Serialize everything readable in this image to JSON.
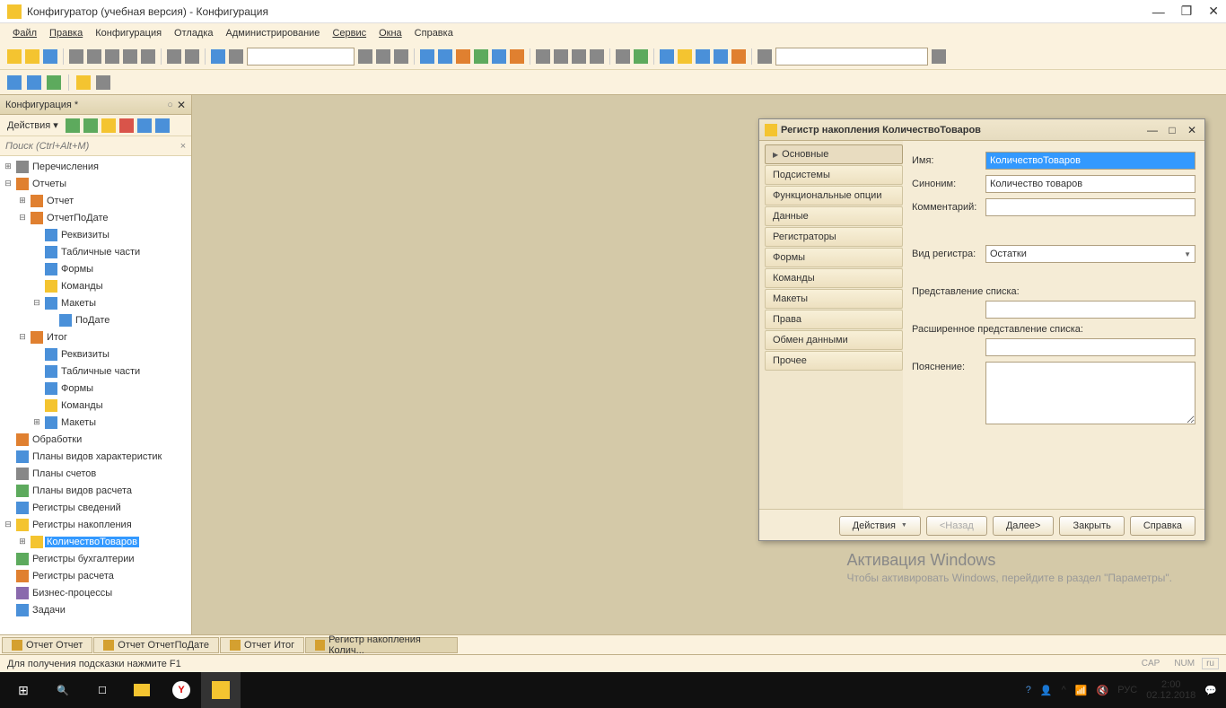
{
  "window": {
    "title": "Конфигуратор (учебная версия) - Конфигурация"
  },
  "menu": {
    "file": "Файл",
    "edit": "Правка",
    "config": "Конфигурация",
    "debug": "Отладка",
    "admin": "Администрирование",
    "service": "Сервис",
    "windows": "Окна",
    "help": "Справка"
  },
  "sidebar": {
    "title": "Конфигурация *",
    "actions": "Действия",
    "search_placeholder": "Поиск (Ctrl+Alt+M)",
    "items": {
      "enums": "Перечисления",
      "reports": "Отчеты",
      "report": "Отчет",
      "reportByDate": "ОтчетПоДате",
      "requisites": "Реквизиты",
      "tabParts": "Табличные части",
      "forms": "Формы",
      "commands": "Команды",
      "layouts": "Макеты",
      "byDate": "ПоДате",
      "itog": "Итог",
      "processing": "Обработки",
      "charTypes": "Планы видов характеристик",
      "accountPlans": "Планы счетов",
      "calcPlans": "Планы видов расчета",
      "infoRegs": "Регистры сведений",
      "accumRegs": "Регистры накопления",
      "qtyGoods": "КоличествоТоваров",
      "bookRegs": "Регистры бухгалтерии",
      "calcRegs": "Регистры расчета",
      "bizproc": "Бизнес-процессы",
      "tasks": "Задачи"
    }
  },
  "dialog": {
    "title": "Регистр накопления КоличествоТоваров",
    "tabs": {
      "main": "Основные",
      "subsystems": "Подсистемы",
      "funcOpts": "Функциональные опции",
      "data": "Данные",
      "registrators": "Регистраторы",
      "forms": "Формы",
      "commands": "Команды",
      "layouts": "Макеты",
      "rights": "Права",
      "exchange": "Обмен данными",
      "other": "Прочее"
    },
    "labels": {
      "name": "Имя:",
      "synonym": "Синоним:",
      "comment": "Комментарий:",
      "regType": "Вид регистра:",
      "listRepr": "Представление списка:",
      "extListRepr": "Расширенное представление списка:",
      "explanation": "Пояснение:"
    },
    "values": {
      "name": "КоличествоТоваров",
      "synonym": "Количество товаров",
      "comment": "",
      "regType": "Остатки",
      "listRepr": "",
      "extListRepr": ""
    },
    "buttons": {
      "actions": "Действия",
      "back": "<Назад",
      "next": "Далее>",
      "close": "Закрыть",
      "help": "Справка"
    }
  },
  "bottomTabs": {
    "t1": "Отчет Отчет",
    "t2": "Отчет ОтчетПоДате",
    "t3": "Отчет Итог",
    "t4": "Регистр накопления Колич..."
  },
  "statusbar": {
    "text": "Для получения подсказки нажмите F1",
    "cap": "CAP",
    "num": "NUM",
    "lang": "ru"
  },
  "activation": {
    "title": "Активация Windows",
    "text": "Чтобы активировать Windows, перейдите в раздел \"Параметры\"."
  },
  "taskbar": {
    "lang": "РУС",
    "time": "2:00",
    "date": "02.12.2018"
  }
}
